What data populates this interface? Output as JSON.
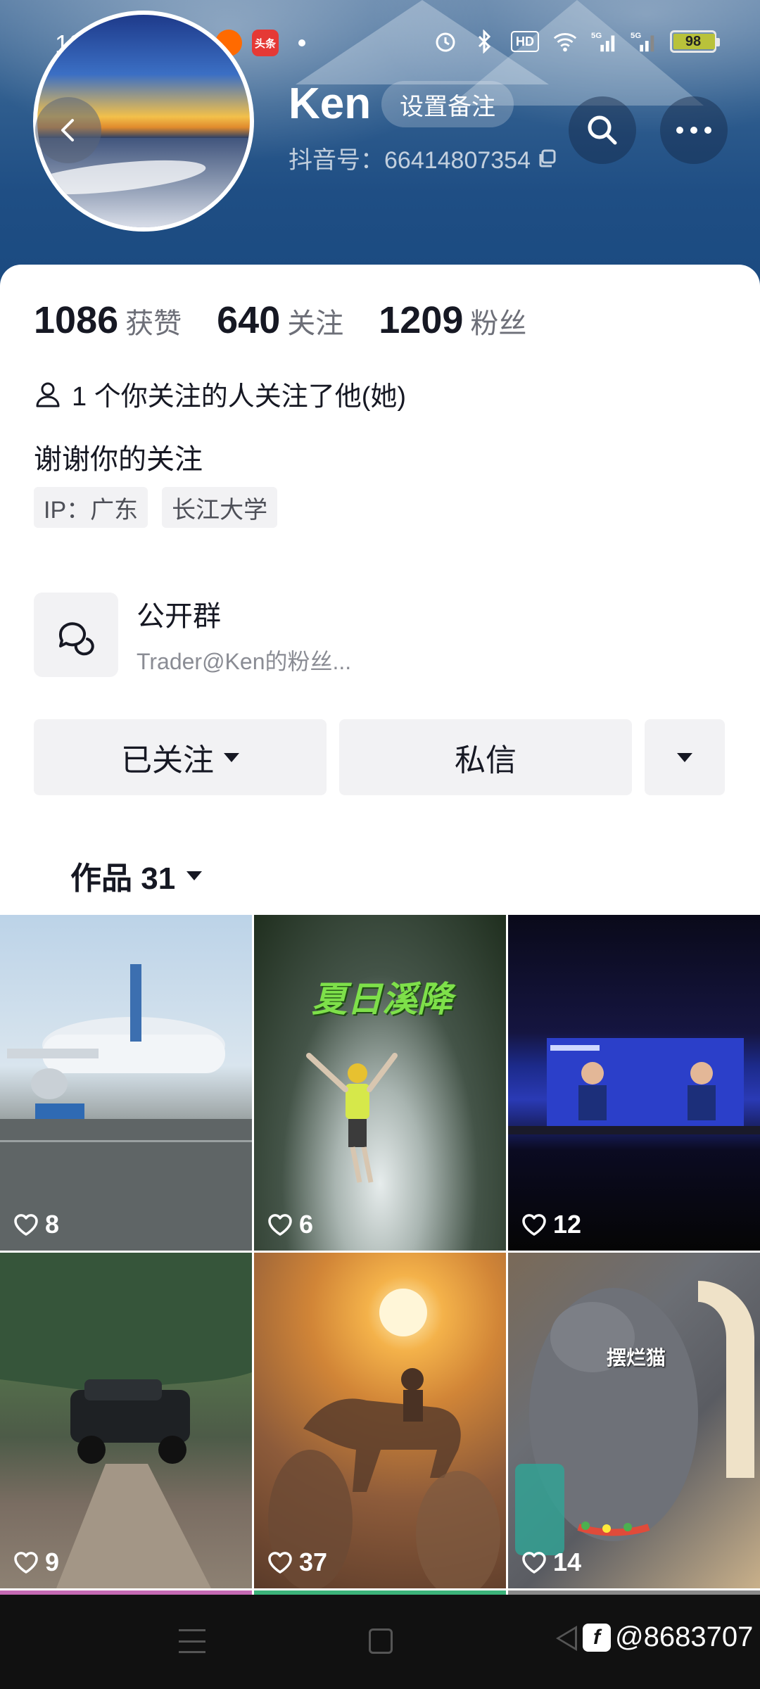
{
  "status_bar": {
    "time": "10:59",
    "apps": [
      "58",
      "",
      "",
      "头条"
    ],
    "network": [
      "HD",
      "5G",
      "5G"
    ],
    "battery": "98",
    "battery_fill": 0.98
  },
  "profile": {
    "name": "Ken",
    "remark_button": "设置备注",
    "douyin_id": "抖音号：66414807354",
    "stats": [
      {
        "num": "1086",
        "label": "获赞"
      },
      {
        "num": "640",
        "label": "关注"
      },
      {
        "num": "1209",
        "label": "粉丝"
      }
    ],
    "mutual_follow": "1 个你关注的人关注了他(她)",
    "bio": "谢谢你的关注",
    "tags": [
      "IP：广东",
      "长江大学"
    ]
  },
  "group": {
    "title": "公开群",
    "subtitle": "Trader@Ken的粉丝..."
  },
  "actions": {
    "following": "已关注",
    "message": "私信"
  },
  "works_tab": "作品 31",
  "videos": [
    {
      "likes": "8",
      "caption": ""
    },
    {
      "likes": "6",
      "caption": "夏日溪降"
    },
    {
      "likes": "12",
      "caption": ""
    },
    {
      "likes": "9",
      "caption": ""
    },
    {
      "likes": "37",
      "caption": ""
    },
    {
      "likes": "14",
      "caption": "摆烂猫"
    }
  ],
  "watermark": "@8683707",
  "colors": {
    "header_blue": "#1f4e84",
    "text_primary": "#161823",
    "text_secondary": "#6d6f78",
    "button_bg": "#f2f2f4"
  }
}
